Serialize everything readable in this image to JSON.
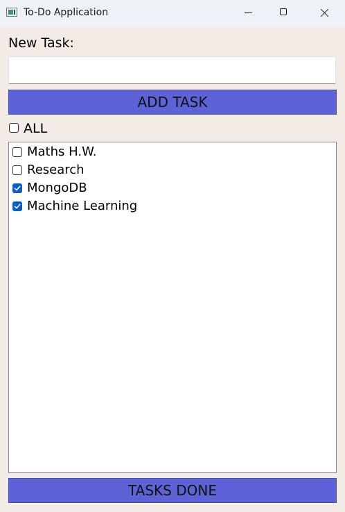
{
  "window": {
    "title": "To-Do Application",
    "icon": "app-window-icon"
  },
  "form": {
    "new_task_label": "New Task:",
    "new_task_value": "",
    "add_button_label": "ADD TASK"
  },
  "select_all": {
    "label": "ALL",
    "checked": false
  },
  "tasks": [
    {
      "label": "Maths H.W.",
      "checked": false
    },
    {
      "label": "Research",
      "checked": false
    },
    {
      "label": "MongoDB",
      "checked": true
    },
    {
      "label": "Machine Learning",
      "checked": true
    }
  ],
  "footer": {
    "done_button_label": "TASKS DONE"
  },
  "colors": {
    "window_bg": "#f3ebe6",
    "button_bg": "#5d62d6",
    "checkbox_checked": "#0b5cc7"
  }
}
